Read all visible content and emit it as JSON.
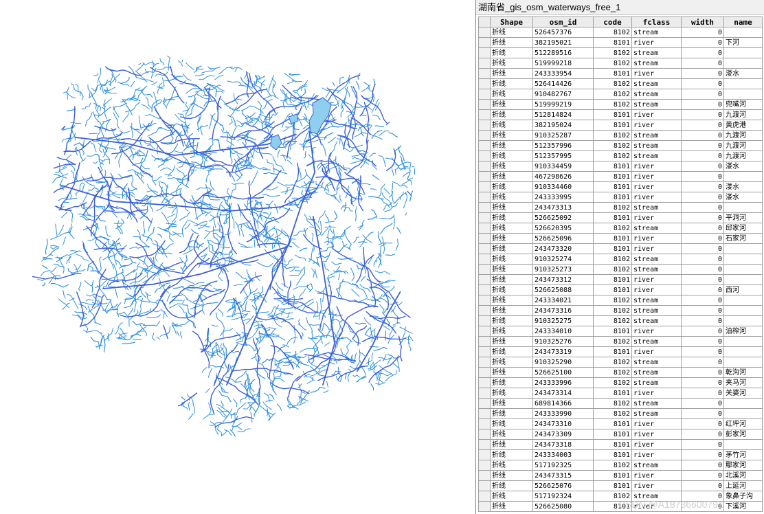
{
  "window": {
    "title": "湖南省_gis_osm_waterways_free_1"
  },
  "colors": {
    "river": "#3d5ed8",
    "stream": "#2d8fe0",
    "lake": "#8ecff0"
  },
  "map": {
    "description_free": true
  },
  "table": {
    "columns": [
      "Shape",
      "osm_id",
      "code",
      "fclass",
      "width",
      "name"
    ],
    "rows": [
      [
        "折线",
        "526457376",
        "8102",
        "stream",
        "0",
        ""
      ],
      [
        "折线",
        "382195021",
        "8101",
        "river",
        "0",
        "下河"
      ],
      [
        "折线",
        "512289516",
        "8102",
        "stream",
        "0",
        ""
      ],
      [
        "折线",
        "519999218",
        "8102",
        "stream",
        "0",
        ""
      ],
      [
        "折线",
        "243333954",
        "8101",
        "river",
        "0",
        "溇水"
      ],
      [
        "折线",
        "526414426",
        "8102",
        "stream",
        "0",
        ""
      ],
      [
        "折线",
        "910482767",
        "8102",
        "stream",
        "0",
        ""
      ],
      [
        "折线",
        "519999219",
        "8102",
        "stream",
        "0",
        "兜嘴河"
      ],
      [
        "折线",
        "512814824",
        "8101",
        "river",
        "0",
        "九渡河"
      ],
      [
        "折线",
        "382195024",
        "8101",
        "river",
        "0",
        "黄虎港"
      ],
      [
        "折线",
        "910325287",
        "8102",
        "stream",
        "0",
        "九渡河"
      ],
      [
        "折线",
        "512357996",
        "8102",
        "stream",
        "0",
        "九渡河"
      ],
      [
        "折线",
        "512357995",
        "8102",
        "stream",
        "0",
        "九渡河"
      ],
      [
        "折线",
        "910334459",
        "8101",
        "river",
        "0",
        "溇水"
      ],
      [
        "折线",
        "467298626",
        "8101",
        "river",
        "0",
        ""
      ],
      [
        "折线",
        "910334460",
        "8101",
        "river",
        "0",
        "溇水"
      ],
      [
        "折线",
        "243333995",
        "8101",
        "river",
        "0",
        "溇水"
      ],
      [
        "折线",
        "243473313",
        "8102",
        "stream",
        "0",
        ""
      ],
      [
        "折线",
        "526625092",
        "8101",
        "river",
        "0",
        "平洞河"
      ],
      [
        "折线",
        "526620395",
        "8102",
        "stream",
        "0",
        "邱家河"
      ],
      [
        "折线",
        "526625096",
        "8101",
        "river",
        "0",
        "石家河"
      ],
      [
        "折线",
        "243473320",
        "8101",
        "river",
        "0",
        ""
      ],
      [
        "折线",
        "910325274",
        "8102",
        "stream",
        "0",
        ""
      ],
      [
        "折线",
        "910325273",
        "8102",
        "stream",
        "0",
        ""
      ],
      [
        "折线",
        "243473312",
        "8101",
        "river",
        "0",
        ""
      ],
      [
        "折线",
        "526625088",
        "8101",
        "river",
        "0",
        "西河"
      ],
      [
        "折线",
        "243334021",
        "8102",
        "stream",
        "0",
        ""
      ],
      [
        "折线",
        "243473316",
        "8102",
        "stream",
        "0",
        ""
      ],
      [
        "折线",
        "910325275",
        "8102",
        "stream",
        "0",
        ""
      ],
      [
        "折线",
        "243334010",
        "8101",
        "river",
        "0",
        "油榨河"
      ],
      [
        "折线",
        "910325276",
        "8102",
        "stream",
        "0",
        ""
      ],
      [
        "折线",
        "243473319",
        "8101",
        "river",
        "0",
        ""
      ],
      [
        "折线",
        "910325290",
        "8102",
        "stream",
        "0",
        ""
      ],
      [
        "折线",
        "526625100",
        "8102",
        "stream",
        "0",
        "乾沟河"
      ],
      [
        "折线",
        "243333996",
        "8102",
        "stream",
        "0",
        "夹马河"
      ],
      [
        "折线",
        "243473314",
        "8101",
        "river",
        "0",
        "关婆河"
      ],
      [
        "折线",
        "689814366",
        "8102",
        "stream",
        "0",
        ""
      ],
      [
        "折线",
        "243333990",
        "8102",
        "stream",
        "0",
        ""
      ],
      [
        "折线",
        "243473310",
        "8101",
        "river",
        "0",
        "红坪河"
      ],
      [
        "折线",
        "243473309",
        "8101",
        "river",
        "0",
        "彭家河"
      ],
      [
        "折线",
        "243473318",
        "8101",
        "river",
        "0",
        ""
      ],
      [
        "折线",
        "243334003",
        "8101",
        "river",
        "0",
        "茅竹河"
      ],
      [
        "折线",
        "517192325",
        "8102",
        "stream",
        "0",
        "鄢家河"
      ],
      [
        "折线",
        "243473315",
        "8101",
        "river",
        "0",
        "北溪河"
      ],
      [
        "折线",
        "526625076",
        "8101",
        "river",
        "0",
        "上延河"
      ],
      [
        "折线",
        "517192324",
        "8102",
        "stream",
        "0",
        "象鼻子沟"
      ],
      [
        "折线",
        "526625080",
        "8101",
        "river",
        "0",
        "下溪河"
      ]
    ]
  },
  "watermark": "CSDN @A18736600791"
}
